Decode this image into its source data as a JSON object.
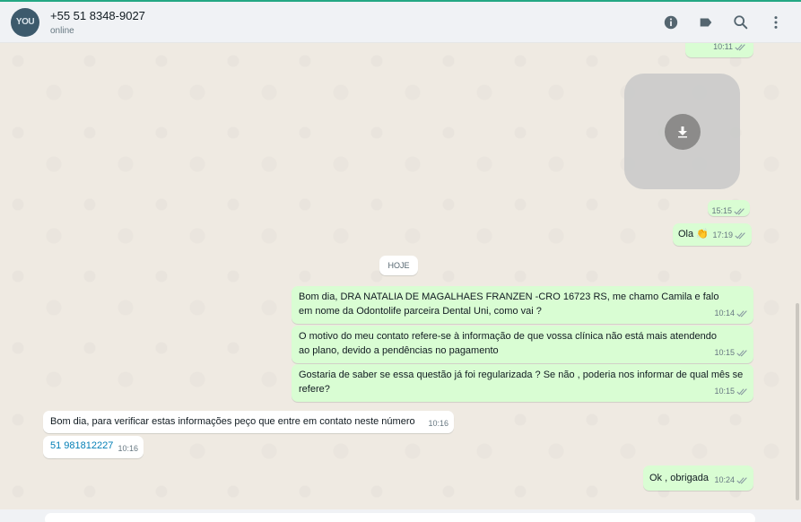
{
  "header": {
    "avatar_text": "YOU",
    "contact_name": "+55 51 8348-9027",
    "status": "online"
  },
  "chat": {
    "day_chip": "HOJE",
    "messages": [
      {
        "id": "m0",
        "direction": "out",
        "text": "",
        "time": "10:11"
      },
      {
        "id": "m1",
        "direction": "out",
        "type": "media",
        "text": "",
        "time": "15:15"
      },
      {
        "id": "m2",
        "direction": "out",
        "text": "Ola 👏",
        "time": "17:19"
      },
      {
        "id": "m3",
        "direction": "out",
        "text": "Bom dia, DRA NATALIA DE MAGALHAES FRANZEN -CRO 16723 RS, me chamo Camila e falo em nome da Odontolife parceira Dental Uni, como vai ?",
        "time": "10:14"
      },
      {
        "id": "m4",
        "direction": "out",
        "text": "O motivo do meu contato refere-se à informação de que vossa clínica não está mais atendendo ao plano, devido a pendências no pagamento",
        "time": "10:15"
      },
      {
        "id": "m5",
        "direction": "out",
        "text": "Gostaria de saber se essa questão já foi regularizada ? Se não , poderia nos informar de qual mês se refere?",
        "time": "10:15"
      },
      {
        "id": "m6",
        "direction": "in",
        "text": "Bom dia, para verificar estas informações peço que entre em contato neste número",
        "time": "10:16"
      },
      {
        "id": "m7",
        "direction": "in",
        "text": "51 981812227",
        "time": "10:16"
      },
      {
        "id": "m8",
        "direction": "out",
        "text": "Ok , obrigada",
        "time": "10:24"
      }
    ]
  },
  "colors": {
    "outgoing": "#d9fdd3",
    "incoming": "#ffffff",
    "background": "#efeae2",
    "accent": "#25a884",
    "ticks": "#8696a0"
  }
}
